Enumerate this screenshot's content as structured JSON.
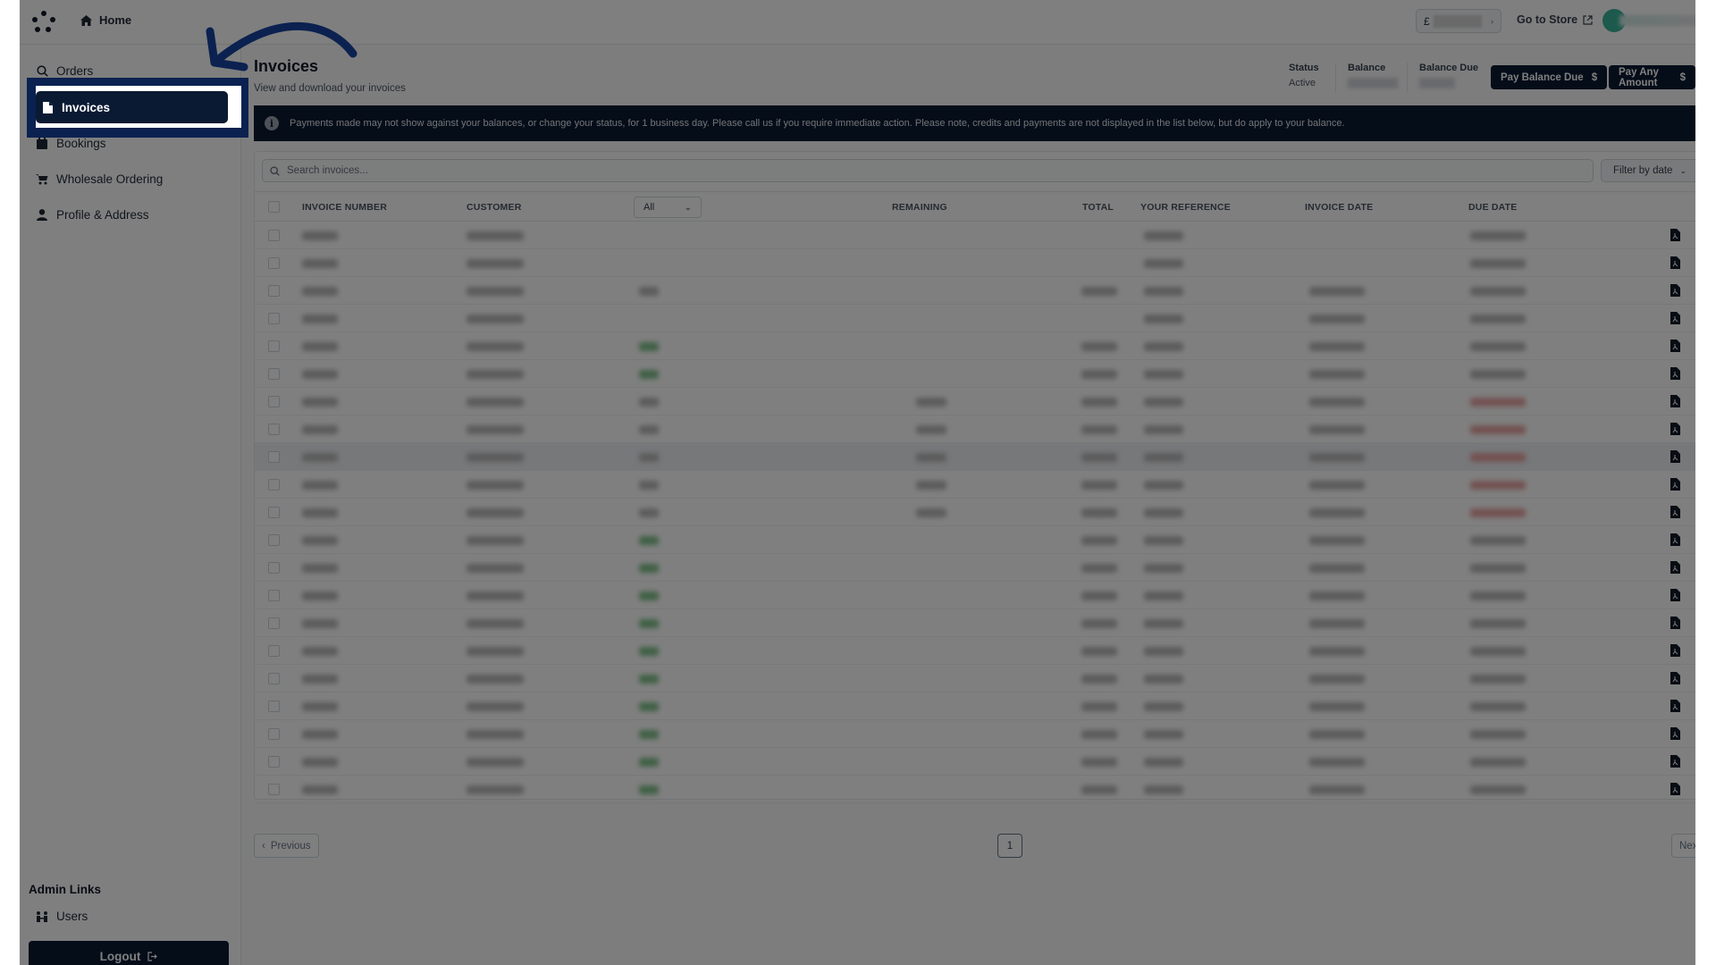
{
  "topbar": {
    "home_label": "Home",
    "account_initial": "£",
    "go_to_store_label": "Go to Store"
  },
  "sidebar": {
    "items": [
      {
        "label": "Orders",
        "icon": "search-icon"
      },
      {
        "label": "Invoices",
        "icon": "file-icon",
        "active": true
      },
      {
        "label": "Bookings",
        "icon": "calendar-icon"
      },
      {
        "label": "Wholesale Ordering",
        "icon": "cart-icon"
      },
      {
        "label": "Profile & Address",
        "icon": "user-icon"
      }
    ],
    "admin_title": "Admin Links",
    "admin_items": [
      {
        "label": "Users",
        "icon": "users-icon"
      }
    ],
    "logout_label": "Logout"
  },
  "page": {
    "title": "Invoices",
    "subtitle": "View and download your invoices"
  },
  "summary": {
    "status_label": "Status",
    "status_value": "Active",
    "balance_label": "Balance",
    "balance_due_label": "Balance Due"
  },
  "actions": {
    "pay_balance_due": "Pay Balance Due",
    "pay_any_amount": "Pay Any Amount",
    "currency_symbol": "$"
  },
  "banner": {
    "icon": "info-icon",
    "text": "Payments made may not show against your balances, or change your status, for 1 business day. Please call us if you require immediate action. Please note, credits and payments are not displayed in the list below, but do apply to your balance."
  },
  "table": {
    "search_placeholder": "Search invoices...",
    "filter_label": "Filter by date",
    "status_filter_value": "All",
    "columns": [
      "INVOICE NUMBER",
      "CUSTOMER",
      "REMAINING",
      "TOTAL",
      "YOUR REFERENCE",
      "INVOICE DATE",
      "DUE DATE"
    ],
    "row_count": 21,
    "rows_redacted": true
  },
  "pagination": {
    "previous_label": "Previous",
    "current_page": "1",
    "next_label": "Next"
  },
  "annotation": {
    "highlighted_item": "Invoices",
    "arrow_color": "#0b2150"
  },
  "colors": {
    "primary": "#0b1a33",
    "avatar": "#3bb39a",
    "status_paid": "#7fc28a",
    "overdue": "#e7a3a3"
  }
}
